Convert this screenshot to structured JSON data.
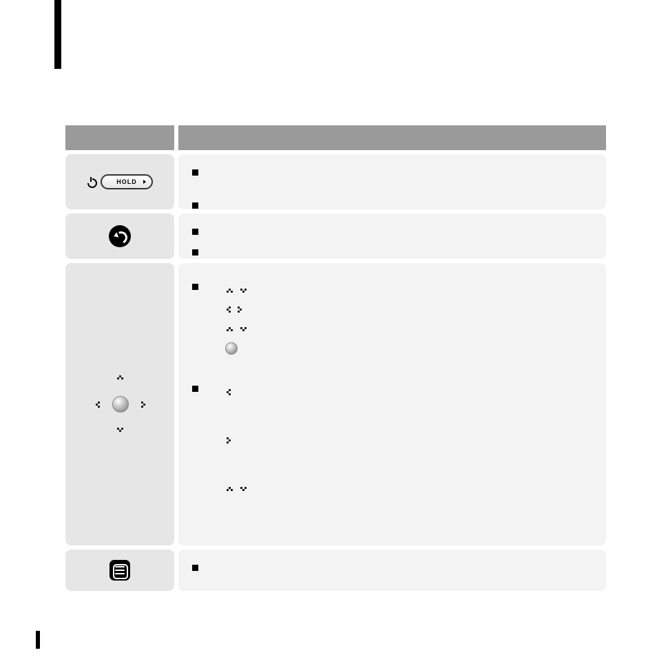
{
  "header": {
    "button_col": "",
    "function_col": ""
  },
  "rows": {
    "power": {
      "icon_label": "HOLD",
      "bullets": [
        "",
        ""
      ]
    },
    "back": {
      "bullets": [
        "",
        ""
      ]
    },
    "nav": {
      "bullets": [
        {
          "text": "",
          "subs": [
            "",
            "",
            "",
            ""
          ]
        },
        {
          "text": "",
          "subs": [
            "",
            "",
            ""
          ]
        }
      ]
    },
    "menu": {
      "bullets": [
        ""
      ]
    }
  },
  "page_number": ""
}
